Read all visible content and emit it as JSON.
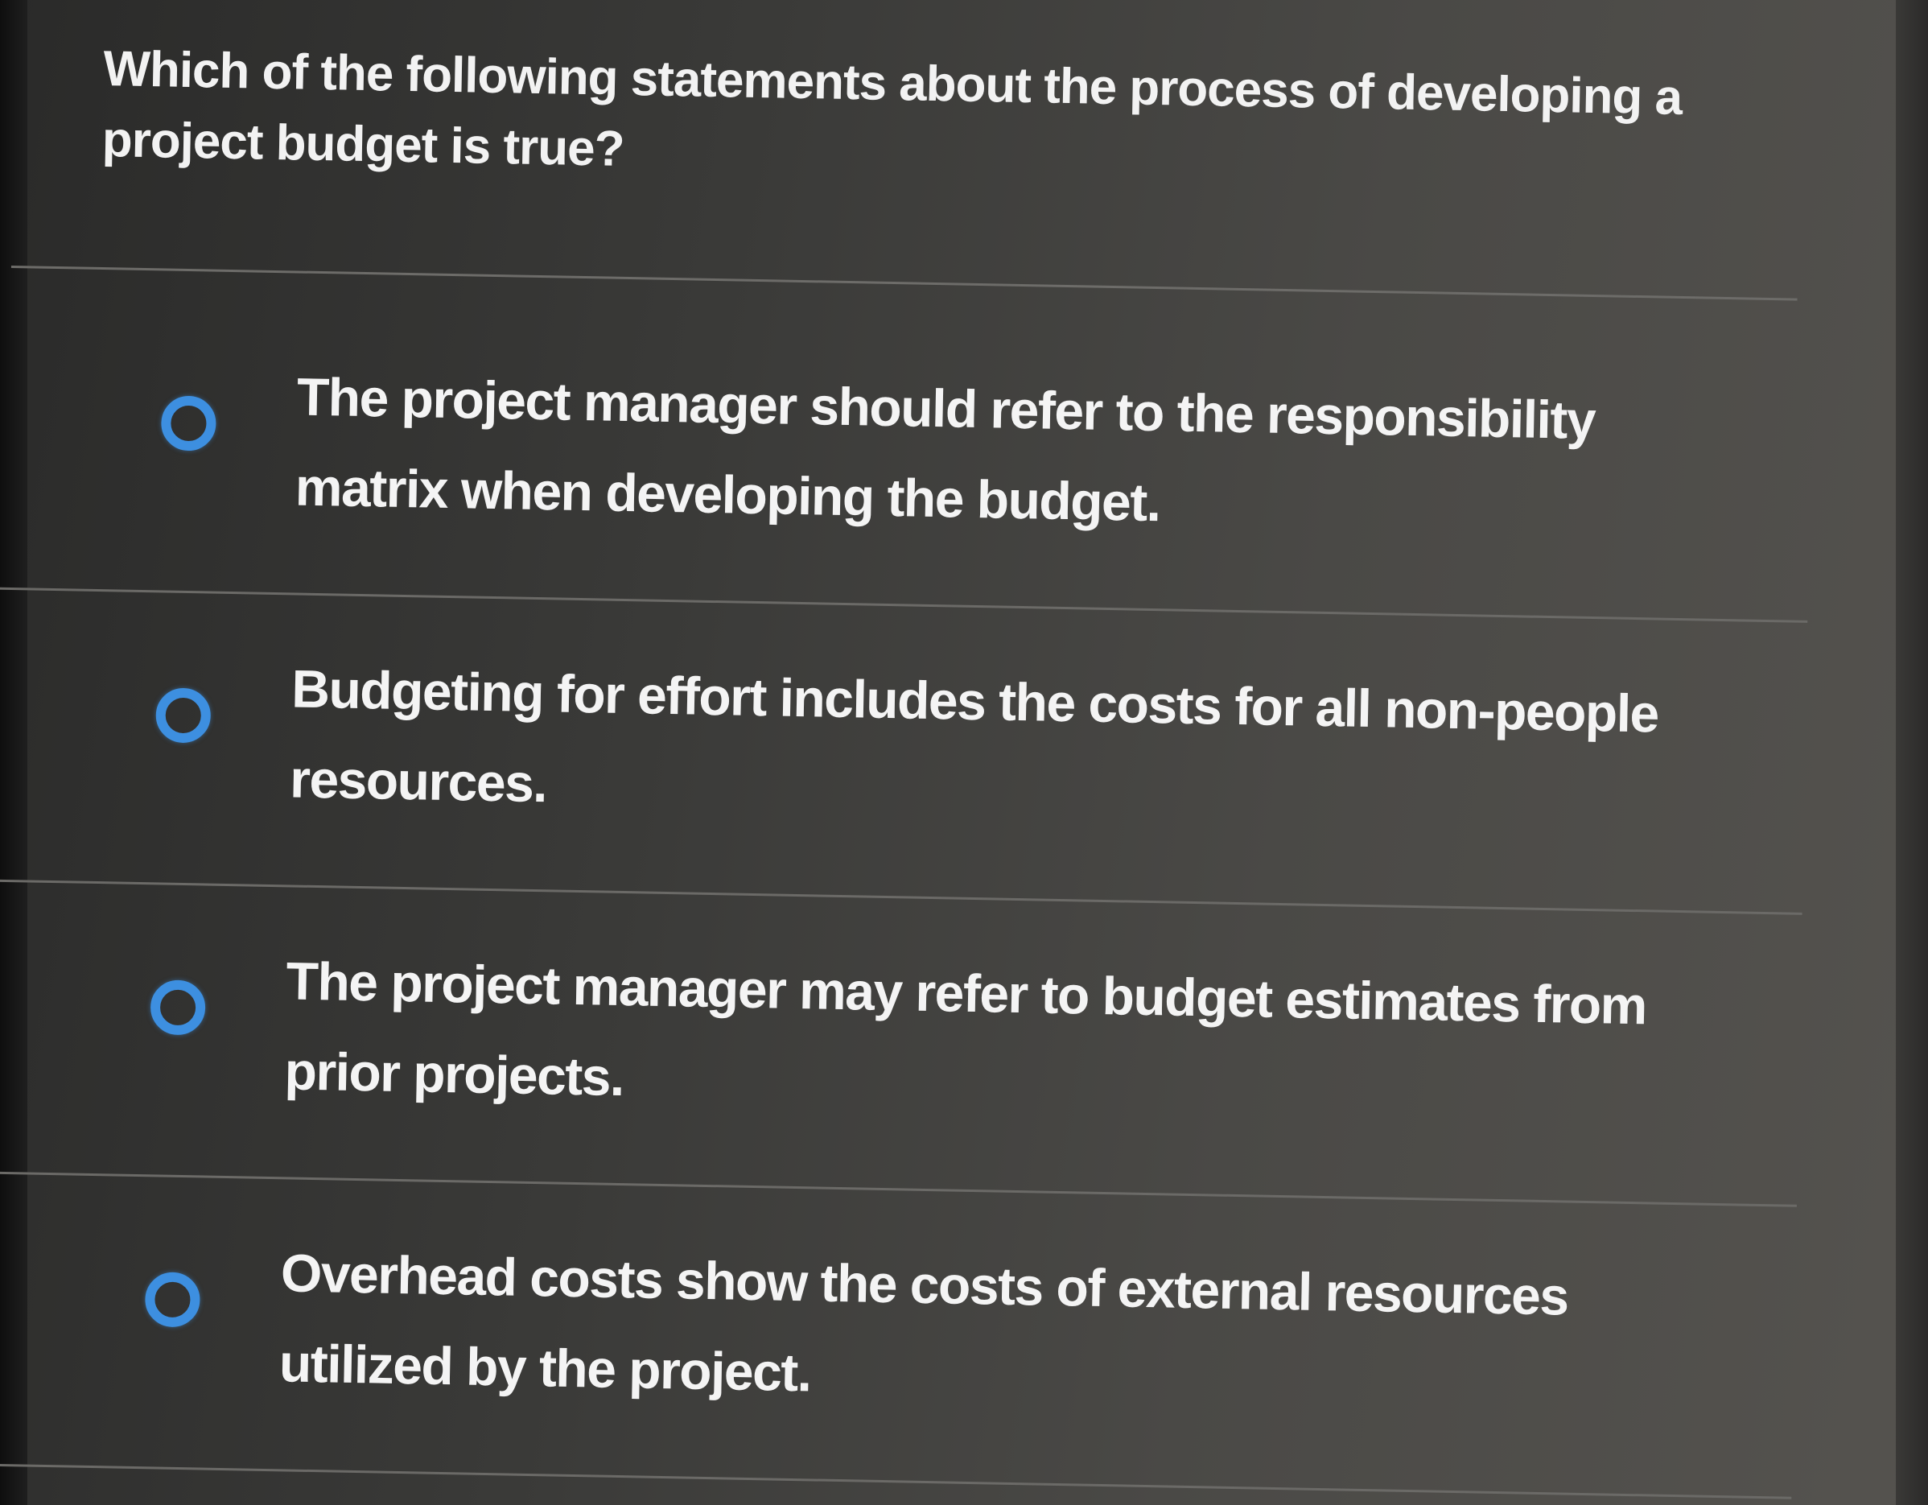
{
  "question": {
    "text": "Which of the following statements about the process of developing a project budget is true?"
  },
  "options": [
    {
      "label": "The project manager should refer to the responsibility matrix when developing the budget.",
      "selected": false
    },
    {
      "label": "Budgeting for effort includes the costs for all non-people resources.",
      "selected": false
    },
    {
      "label": "The project manager may refer to budget estimates from prior projects.",
      "selected": false
    },
    {
      "label": "Overhead costs show the costs of external resources utilized by the project.",
      "selected": false
    }
  ],
  "colors": {
    "radio_accent": "#3d8fe0",
    "background": "#3a3a38",
    "text": "#f2f2f2"
  }
}
